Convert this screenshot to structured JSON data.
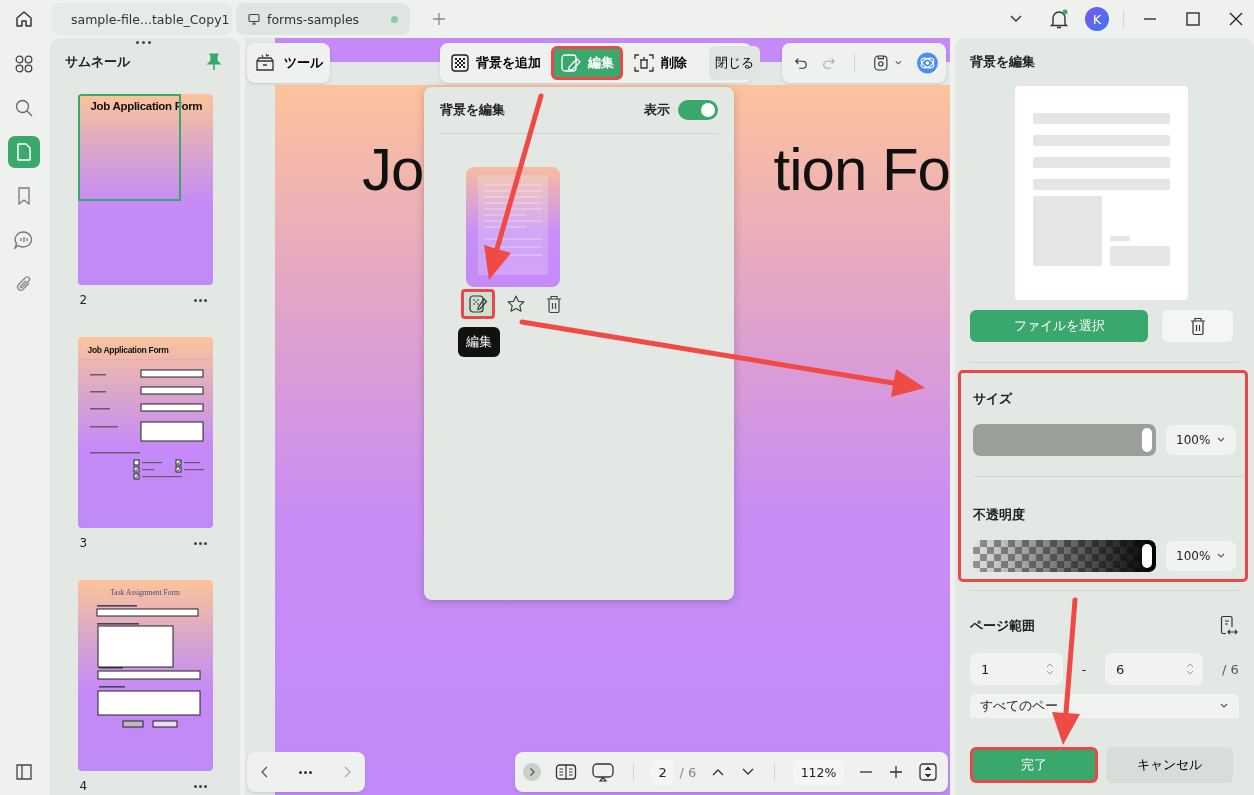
{
  "tabs": [
    {
      "label": "sample-file...table_Copy1",
      "selected": false
    },
    {
      "label": "forms-samples",
      "selected": true
    }
  ],
  "notifications": {
    "unread": true
  },
  "user": {
    "initial": "K"
  },
  "sidebar": {
    "items": [
      {
        "kind": "apps",
        "selected": false
      },
      {
        "kind": "search",
        "selected": false
      },
      {
        "kind": "pages",
        "selected": true
      },
      {
        "kind": "bookmark",
        "selected": false
      },
      {
        "kind": "comment",
        "selected": false
      },
      {
        "kind": "attachment",
        "selected": false
      }
    ]
  },
  "thumbnails": {
    "title": "サムネール",
    "pinned": true,
    "pages": [
      {
        "number": "2",
        "kind": "cover",
        "selected": true,
        "title": "Job Application Form"
      },
      {
        "number": "3",
        "kind": "job_form",
        "selected": false,
        "title": "Job Application Form"
      },
      {
        "number": "4",
        "kind": "task_form",
        "selected": false,
        "title": "Task Assignment Form"
      }
    ]
  },
  "toolbar": {
    "tools_label": "ツール",
    "actions": [
      {
        "kind": "add",
        "label": "背景を追加",
        "selected": false,
        "highlighted": false
      },
      {
        "kind": "edit",
        "label": "編集",
        "selected": true,
        "highlighted": true
      },
      {
        "kind": "delete",
        "label": "削除",
        "selected": false,
        "highlighted": false
      },
      {
        "kind": "close",
        "label": "閉じる",
        "selected": false,
        "highlighted": false
      }
    ],
    "redo_disabled": true
  },
  "document": {
    "heading_parts": [
      "Jo",
      "tion Fo"
    ]
  },
  "popup": {
    "title": "背景を編集",
    "show_label": "表示",
    "show": true,
    "item_actions": [
      {
        "kind": "edit",
        "selected": true,
        "highlighted": true
      },
      {
        "kind": "star",
        "selected": false,
        "highlighted": false
      },
      {
        "kind": "delete",
        "selected": false,
        "highlighted": false
      }
    ],
    "tooltip": "編集"
  },
  "panel": {
    "title": "背景を編集",
    "choose_file": "ファイルを選択",
    "highlighted": true,
    "size": {
      "label": "サイズ",
      "level": 1,
      "value": "100%"
    },
    "opacity": {
      "label": "不透明度",
      "level": 1,
      "value": "100%"
    },
    "page_range": {
      "label": "ページ範囲",
      "from": "1",
      "separator": "-",
      "to": "6",
      "total": "/ 6",
      "scope": "すべてのペー"
    },
    "done": "完了",
    "done_highlighted": true,
    "cancel": "キャンセル"
  },
  "pager": {
    "page": "2",
    "total": "/ 6",
    "zoom": "112%"
  }
}
